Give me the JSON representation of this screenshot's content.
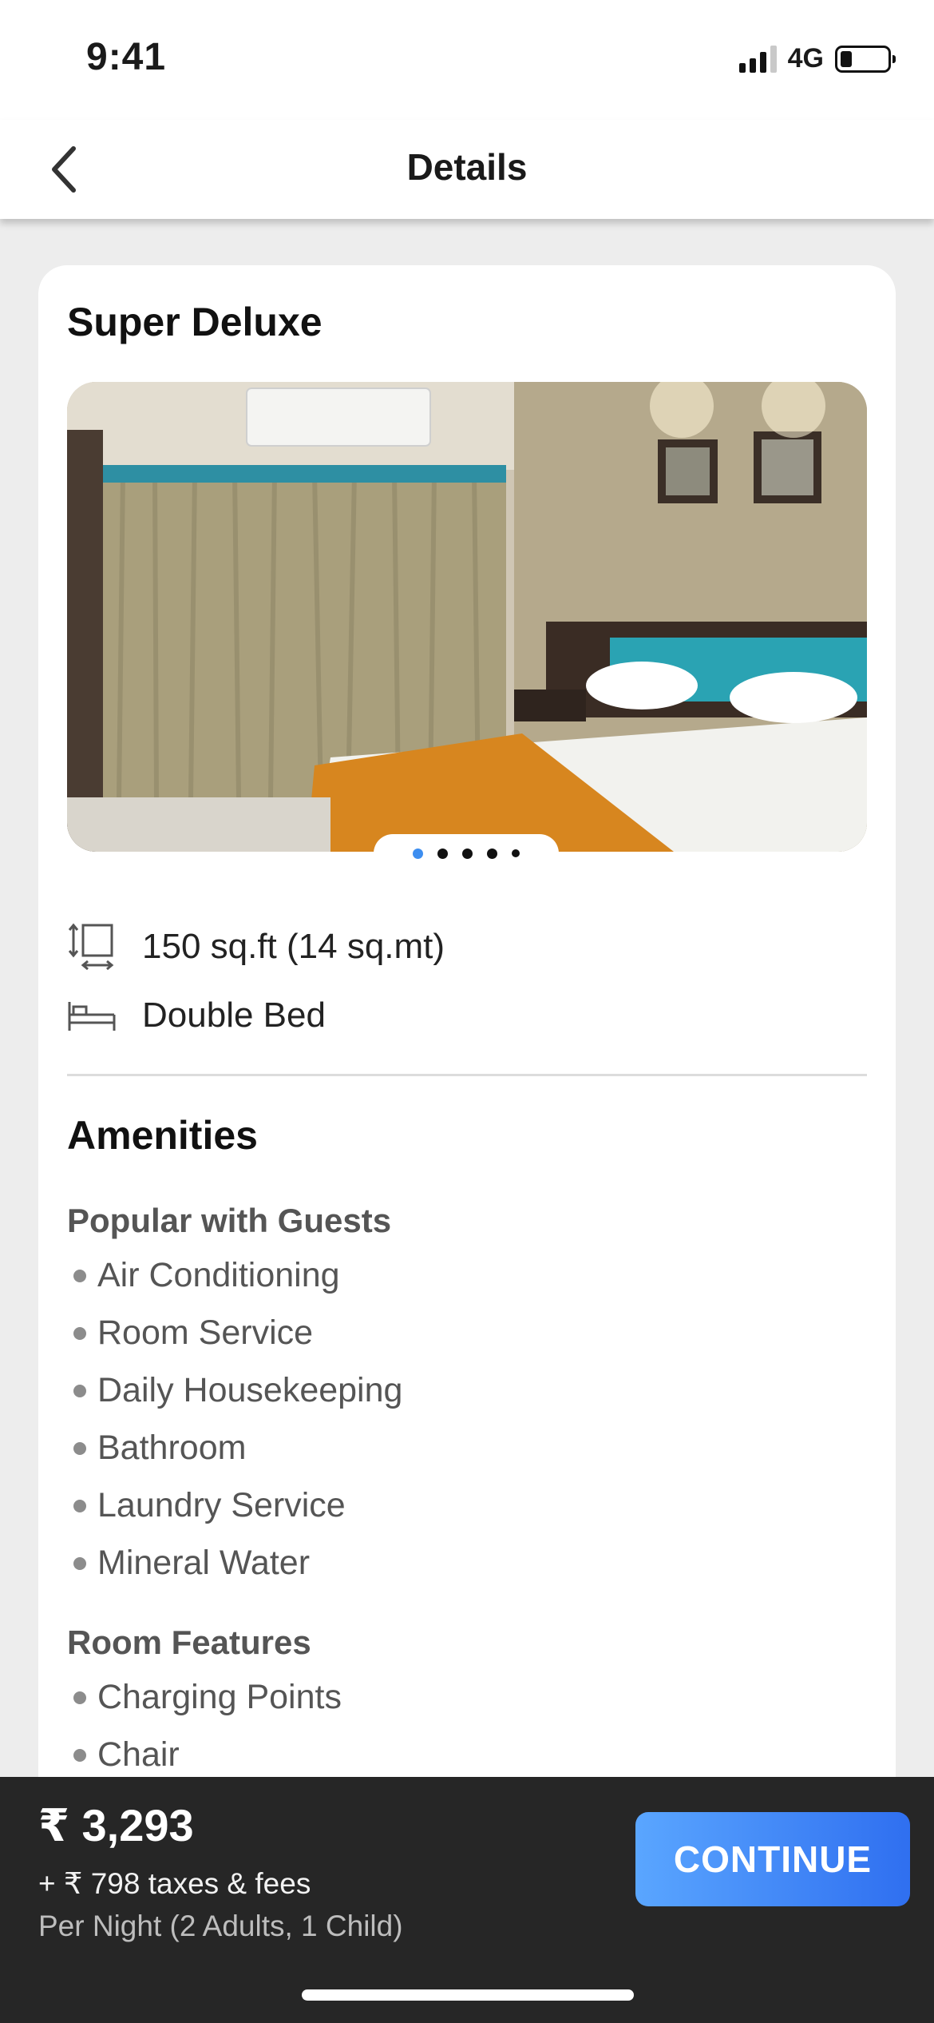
{
  "status_bar": {
    "time": "9:41",
    "network": "4G"
  },
  "header": {
    "title": "Details"
  },
  "room": {
    "name": "Super Deluxe",
    "gallery": {
      "total_images": 5,
      "active_index": 0
    },
    "size": "150 sq.ft (14 sq.mt)",
    "bed": "Double Bed"
  },
  "amenities": {
    "title": "Amenities",
    "groups": [
      {
        "title": "Popular with Guests",
        "items": [
          "Air Conditioning",
          "Room Service",
          "Daily Housekeeping",
          "Bathroom",
          "Laundry Service",
          "Mineral Water"
        ]
      },
      {
        "title": "Room Features",
        "items": [
          "Charging Points",
          "Chair"
        ]
      }
    ]
  },
  "footer": {
    "price": "₹ 3,293",
    "taxes": "+ ₹ 798 taxes & fees",
    "per_night": "Per Night (2 Adults, 1 Child)",
    "continue_label": "CONTINUE"
  },
  "colors": {
    "accent": "#3d8ef0",
    "button_gradient_start": "#5aa6ff",
    "button_gradient_end": "#2f6ff0",
    "footer_bg": "#262626"
  }
}
